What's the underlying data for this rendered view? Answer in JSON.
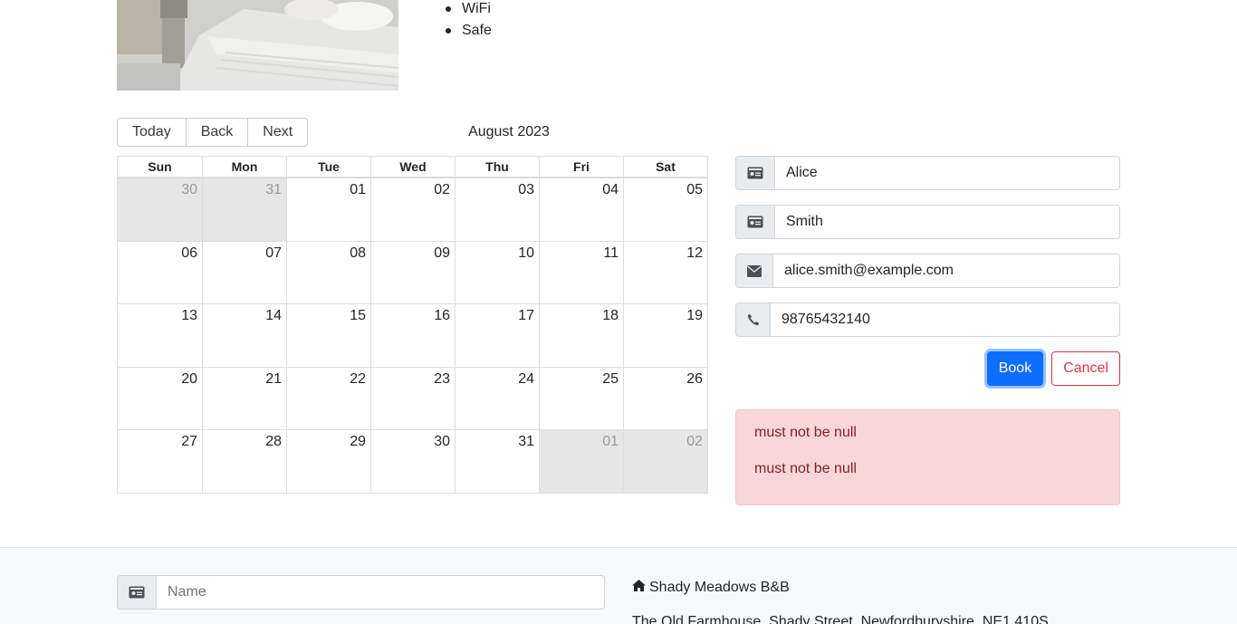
{
  "room": {
    "features": [
      "WiFi",
      "Safe"
    ]
  },
  "calendar": {
    "buttons": {
      "today": "Today",
      "back": "Back",
      "next": "Next"
    },
    "label": "August 2023",
    "weekdays": [
      "Sun",
      "Mon",
      "Tue",
      "Wed",
      "Thu",
      "Fri",
      "Sat"
    ],
    "weeks": [
      [
        "30",
        "31",
        "01",
        "02",
        "03",
        "04",
        "05"
      ],
      [
        "06",
        "07",
        "08",
        "09",
        "10",
        "11",
        "12"
      ],
      [
        "13",
        "14",
        "15",
        "16",
        "17",
        "18",
        "19"
      ],
      [
        "20",
        "21",
        "22",
        "23",
        "24",
        "25",
        "26"
      ],
      [
        "27",
        "28",
        "29",
        "30",
        "31",
        "01",
        "02"
      ]
    ]
  },
  "booking_form": {
    "firstname": "Alice",
    "lastname": "Smith",
    "email": "alice.smith@example.com",
    "phone": "98765432140",
    "book_label": "Book",
    "cancel_label": "Cancel",
    "errors": [
      "must not be null",
      "must not be null"
    ]
  },
  "footer": {
    "name_placeholder": "Name",
    "business_name": "Shady Meadows B&B",
    "address": "The Old Farmhouse, Shady Street, Newfordburyshire, NE1 410S"
  },
  "colors": {
    "primary": "#0d6efd",
    "danger": "#dc3545",
    "alert_bg": "#f8d7da",
    "alert_text": "#842029",
    "off_day_bg": "#e6e6e6"
  },
  "icons": {
    "id_card": "id-card-icon",
    "envelope": "envelope-icon",
    "phone": "phone-icon",
    "home": "home-icon"
  }
}
